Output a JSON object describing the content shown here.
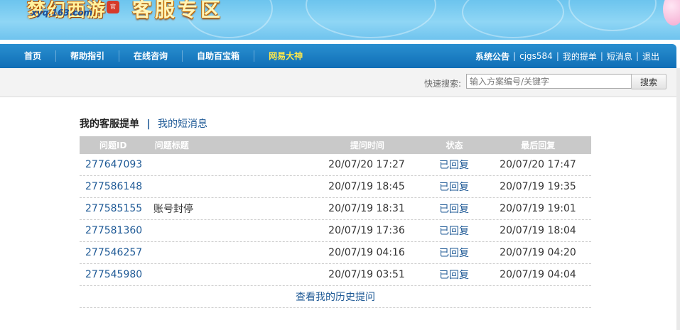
{
  "banner": {
    "logo_text": "梦幻西游",
    "logo_url": "xyq.163.com",
    "logo_badge": "官",
    "title": "客服专区"
  },
  "nav": {
    "items": [
      {
        "label": "首页"
      },
      {
        "label": "帮助指引"
      },
      {
        "label": "在线咨询"
      },
      {
        "label": "自助百宝箱"
      },
      {
        "label": "网易大神"
      }
    ],
    "right": {
      "announcement": "系统公告",
      "username": "cjgs584",
      "my_tickets": "我的提单",
      "messages": "短消息",
      "logout": "退出"
    }
  },
  "search": {
    "label": "快速搜索:",
    "placeholder": "输入方案编号/关键字",
    "button": "搜索"
  },
  "tabs": {
    "active": "我的客服提单",
    "separator": "|",
    "other": "我的短消息"
  },
  "table": {
    "headers": {
      "id": "问题ID",
      "title": "问题标题",
      "time": "提问时间",
      "status": "状态",
      "last": "最后回复"
    },
    "rows": [
      {
        "id": "277647093",
        "title": "",
        "time": "20/07/20 17:27",
        "status": "已回复",
        "last": "20/07/20 17:47"
      },
      {
        "id": "277586148",
        "title": "",
        "time": "20/07/19 18:45",
        "status": "已回复",
        "last": "20/07/19 19:35"
      },
      {
        "id": "277585155",
        "title": "账号封停",
        "time": "20/07/19 18:31",
        "status": "已回复",
        "last": "20/07/19 19:01"
      },
      {
        "id": "277581360",
        "title": "",
        "time": "20/07/19 17:36",
        "status": "已回复",
        "last": "20/07/19 18:04"
      },
      {
        "id": "277546257",
        "title": "",
        "time": "20/07/19 04:16",
        "status": "已回复",
        "last": "20/07/19 04:20"
      },
      {
        "id": "277545980",
        "title": "",
        "time": "20/07/19 03:51",
        "status": "已回复",
        "last": "20/07/19 04:04"
      }
    ],
    "history_link": "查看我的历史提问"
  },
  "colors": {
    "nav_bg": "#0f6eb6",
    "nav_highlight": "#ffe84a",
    "link": "#1f5a96",
    "header_bg": "#c9c9c9"
  }
}
